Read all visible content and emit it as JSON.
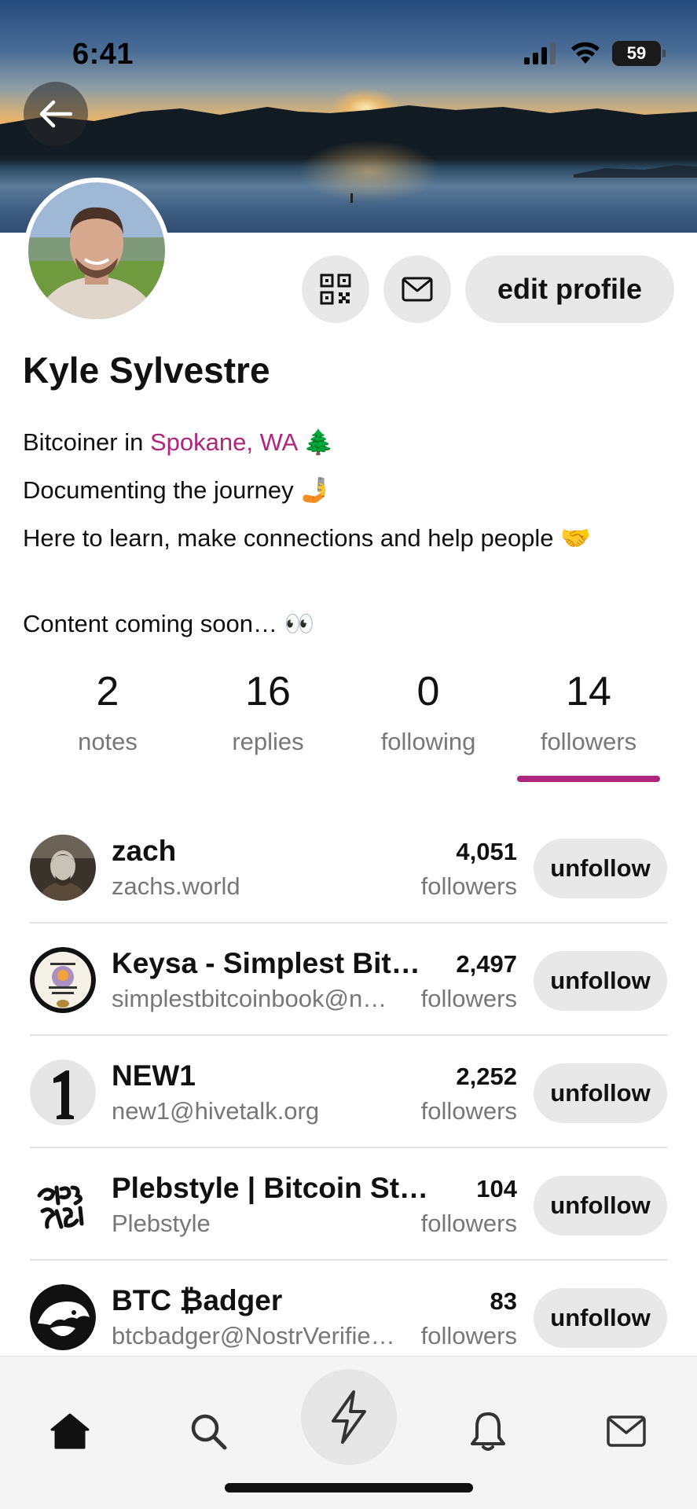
{
  "status_bar": {
    "time": "6:41",
    "battery": "59",
    "icons": [
      "signal-icon",
      "wifi-icon",
      "battery-icon"
    ]
  },
  "header": {
    "back_icon": "arrow-left-icon",
    "qr_icon": "qr-code-icon",
    "message_icon": "envelope-icon",
    "edit_profile_label": "edit profile"
  },
  "profile": {
    "name": "Kyle Sylvestre",
    "bio": {
      "line1_prefix": "Bitcoiner in ",
      "line1_location": "Spokane, WA",
      "line1_suffix": " 🌲",
      "line2": "Documenting the journey 🤳",
      "line3": "Here to learn, make connections and help people 🤝",
      "line4": "Content coming soon… 👀"
    }
  },
  "stats": {
    "notes": {
      "value": "2",
      "label": "notes"
    },
    "replies": {
      "value": "16",
      "label": "replies"
    },
    "following": {
      "value": "0",
      "label": "following"
    },
    "followers": {
      "value": "14",
      "label": "followers"
    },
    "active_tab": "followers"
  },
  "follower_list": [
    {
      "name": "zach",
      "handle": "zachs.world",
      "count": "4,051",
      "count_label": "followers",
      "button": "unfollow"
    },
    {
      "name": "Keysa - Simplest Bitc…",
      "handle": "simplestbitcoinbook@n…",
      "count": "2,497",
      "count_label": "followers",
      "button": "unfollow"
    },
    {
      "name": "NEW1",
      "handle": "new1@hivetalk.org",
      "count": "2,252",
      "count_label": "followers",
      "button": "unfollow"
    },
    {
      "name": "Plebstyle | Bitcoin Stee…",
      "handle": "Plebstyle",
      "count": "104",
      "count_label": "followers",
      "button": "unfollow"
    },
    {
      "name": "BTC ₿adger",
      "handle": "btcbadger@NostrVerifie…",
      "count": "83",
      "count_label": "followers",
      "button": "unfollow"
    }
  ],
  "bottom_nav": {
    "items": [
      "home-icon",
      "search-icon",
      "zap-icon",
      "bell-icon",
      "envelope-icon"
    ],
    "active": "home-icon"
  },
  "colors": {
    "accent": "#b0257d",
    "button_bg": "#e8e8e8",
    "muted_text": "#777777"
  }
}
